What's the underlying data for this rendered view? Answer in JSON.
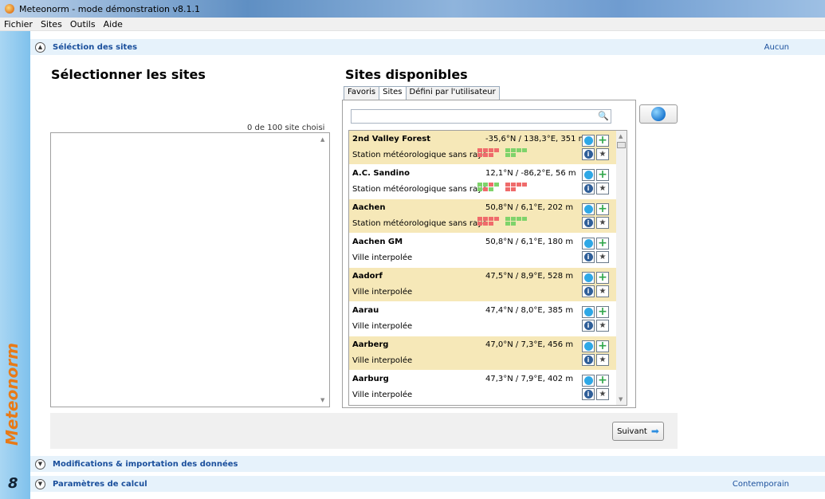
{
  "window": {
    "title": "Meteonorm - mode démonstration v8.1.1"
  },
  "menu": [
    "Fichier",
    "Sites",
    "Outils",
    "Aide"
  ],
  "brand": {
    "name": "Meteonorm",
    "version": "8"
  },
  "sections": [
    {
      "label": "Séléction des sites",
      "value": "Aucun",
      "expanded": true
    },
    {
      "label": "Modifications & importation des données",
      "value": "",
      "expanded": false
    },
    {
      "label": "Paramètres de calcul",
      "value": "Contemporain",
      "expanded": false
    }
  ],
  "left": {
    "heading": "Sélectionner les sites",
    "count_label": "0 de 100 site choisi"
  },
  "right": {
    "heading": "Sites disponibles",
    "tabs": [
      "Favoris",
      "Sites",
      "Défini par l'utilisateur"
    ],
    "active_tab": "Sites",
    "search_value": ""
  },
  "sites": [
    {
      "name": "2nd Valley Forest",
      "coords": "-35,6°N / 138,3°E, 351 m",
      "type": "Station météorologique sans rayonnement",
      "highlight": true,
      "indicators": "station_a"
    },
    {
      "name": "A.C. Sandino",
      "coords": "12,1°N / -86,2°E, 56 m",
      "type": "Station météorologique sans rayonnement",
      "highlight": false,
      "indicators": "station_b"
    },
    {
      "name": "Aachen",
      "coords": "50,8°N / 6,1°E, 202 m",
      "type": "Station météorologique sans rayonnement",
      "highlight": true,
      "indicators": "station_a"
    },
    {
      "name": "Aachen GM",
      "coords": "50,8°N / 6,1°E, 180 m",
      "type": "Ville interpolée",
      "highlight": false,
      "indicators": "none"
    },
    {
      "name": "Aadorf",
      "coords": "47,5°N / 8,9°E, 528 m",
      "type": "Ville interpolée",
      "highlight": true,
      "indicators": "none"
    },
    {
      "name": "Aarau",
      "coords": "47,4°N / 8,0°E, 385 m",
      "type": "Ville interpolée",
      "highlight": false,
      "indicators": "none"
    },
    {
      "name": "Aarberg",
      "coords": "47,0°N / 7,3°E, 456 m",
      "type": "Ville interpolée",
      "highlight": true,
      "indicators": "none"
    },
    {
      "name": "Aarburg",
      "coords": "47,3°N / 7,9°E, 402 m",
      "type": "Ville interpolée",
      "highlight": false,
      "indicators": "none"
    }
  ],
  "footer": {
    "next_label": "Suivant"
  },
  "colors": {
    "accent": "#1a4f9c",
    "highlight_row": "#f6e8b8",
    "brand_orange": "#e87a17",
    "ok_green": "#7fd36b",
    "bad_red": "#ef6b6b"
  },
  "icons": {
    "locate": "globe-icon",
    "add": "plus-icon",
    "info": "info-icon",
    "favorite": "star-icon",
    "search": "search-icon",
    "next": "arrow-right-icon"
  }
}
